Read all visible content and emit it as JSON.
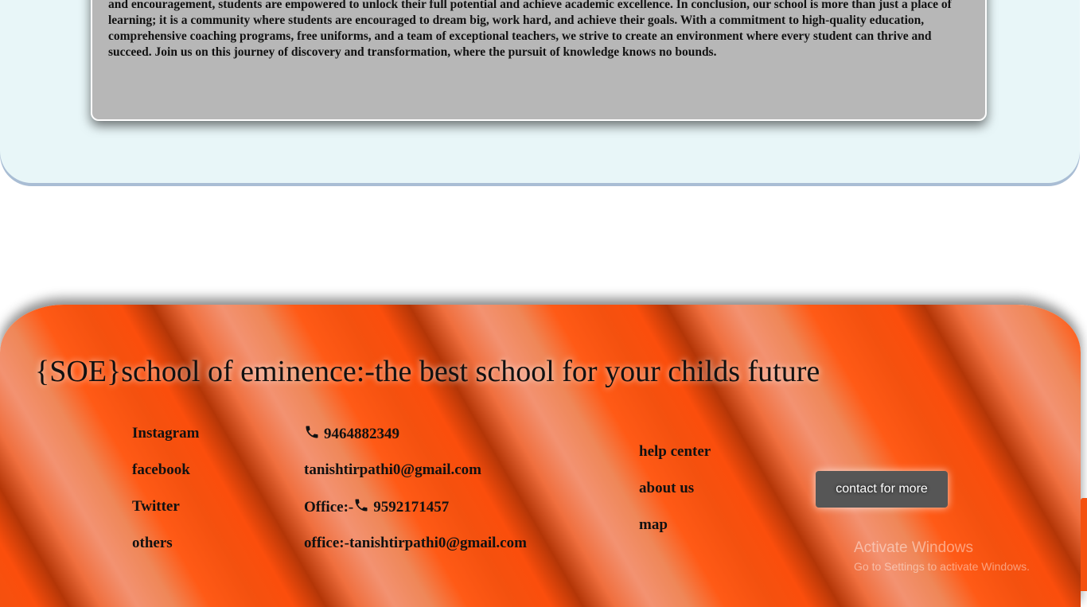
{
  "about": {
    "paragraph": "transformative journey as we strive to shape the leaders of tomorrow and make a positive impact on the world.In addition to academic excellence, our school takes pride in fostering a nurturing and inclusive go above and beyond to inspire a love for learning and instill confidence in their students. With their unwavering support and encouragement, students are empowered to unlock their full potential and achieve academic excellence. In conclusion, our school is more than just a place of learning; it is a community where students are encouraged to dream big, work hard, and achieve their goals. With a commitment to high-quality education, comprehensive coaching programs, free uniforms, and a team of exceptional teachers, we strive to create an environment where every student can thrive and succeed. Join us on this journey of discovery and transformation, where the pursuit of knowledge knows no bounds."
  },
  "footer": {
    "title": "{SOE}school of eminence:-the best school for your childs future",
    "social_links": [
      "Instagram",
      "facebook",
      "Twitter",
      "others"
    ],
    "contact": {
      "phone": "9464882349",
      "email": "tanishtirpathi0@gmail.com",
      "office_prefix": "Office:-",
      "office_phone": "9592171457",
      "office_email": "office:-tanishtirpathi0@gmail.com"
    },
    "links": [
      "help center",
      "about us",
      "map"
    ],
    "contact_button": "contact for more",
    "icons": {
      "phone": "phone-icon"
    },
    "colors": {
      "footer_accent": "#f4510f",
      "button_bg": "#565656",
      "card_bg": "#b7b7b7",
      "section_bg": "#e8f6f8"
    }
  },
  "watermark": {
    "title": "Activate Windows",
    "subtitle": "Go to Settings to activate Windows."
  }
}
